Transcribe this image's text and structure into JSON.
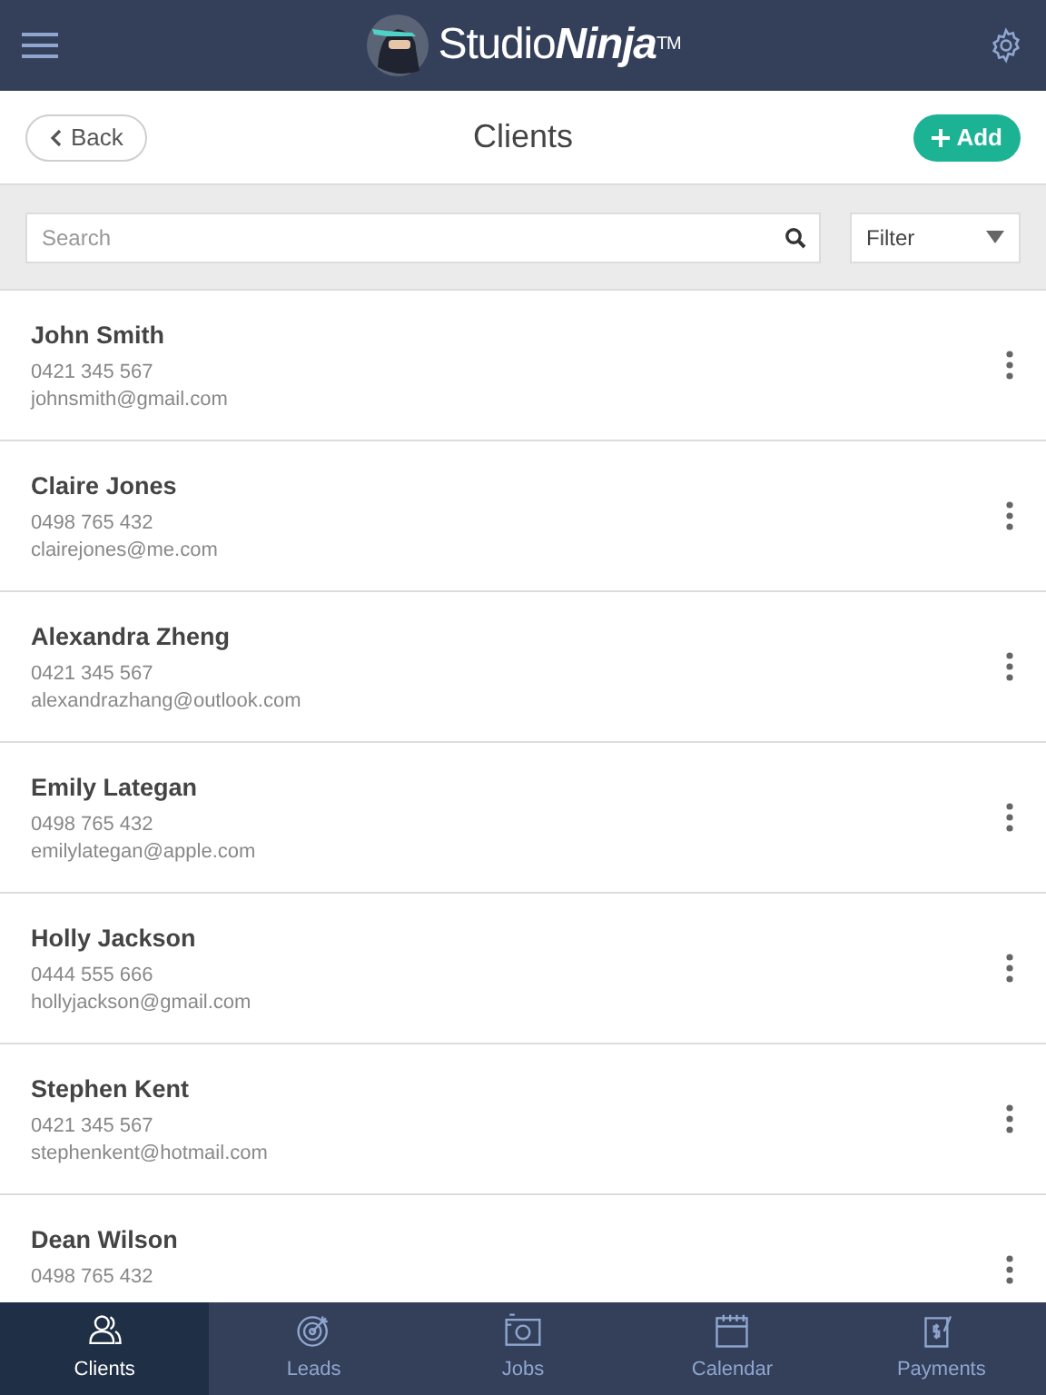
{
  "header": {
    "logo": "Studio**Ninja**$^{TM}$"
  },
  "toolbar": {
    "back": "Back",
    "title": "Clients",
    "add": "Add"
  },
  "search": {
    "placeholder": "Search"
  },
  "filter": {
    "label": "Filter"
  },
  "clients": [
    {
      "name": "John Smith",
      "phone": "0421 345 567",
      "email": "johnsmith@gmail.com"
    },
    {
      "name": "Claire Jones",
      "phone": "0498 765 432",
      "email": "clairejones@me.com"
    },
    {
      "name": "Alexandra Zheng",
      "phone": "0421 345 567",
      "email": "alexandrazhang@outlook.com"
    },
    {
      "name": "Emily Lategan",
      "phone": "0498 765 432",
      "email": "emilylategan@apple.com"
    },
    {
      "name": "Holly Jackson",
      "phone": "0444 555 666",
      "email": "hollyjackson@gmail.com"
    },
    {
      "name": "Stephen Kent",
      "phone": "0421 345 567",
      "email": "stephenkent@hotmail.com"
    },
    {
      "name": "Dean Wilson",
      "phone": "0498 765 432"
    }
  ],
  "tabs": [
    {
      "label": "Clients",
      "kind": "clients",
      "selected": true
    },
    {
      "label": "Leads",
      "kind": "leads",
      "selected": false
    },
    {
      "label": "Jobs",
      "kind": "jobs",
      "selected": false
    },
    {
      "label": "Calendar",
      "kind": "calendar",
      "selected": false
    },
    {
      "label": "Payments",
      "kind": "payments",
      "selected": false
    }
  ]
}
